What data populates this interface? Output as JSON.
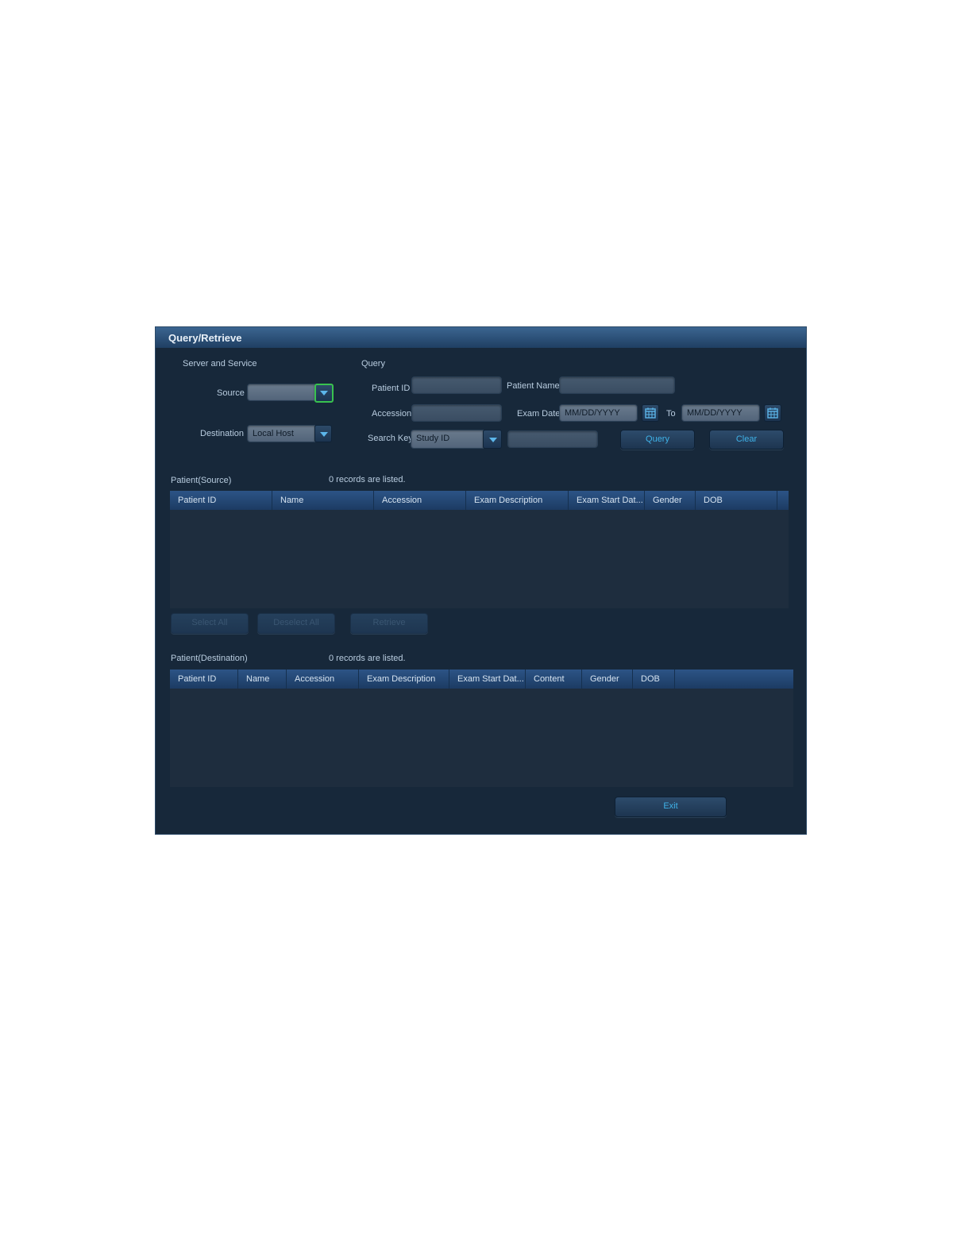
{
  "window": {
    "title": "Query/Retrieve"
  },
  "server": {
    "section_label": "Server and Service",
    "source_label": "Source",
    "source_value": "",
    "destination_label": "Destination",
    "destination_value": "Local Host"
  },
  "query": {
    "section_label": "Query",
    "patient_id_label": "Patient ID",
    "patient_id_value": "",
    "patient_name_label": "Patient Name",
    "patient_name_value": "",
    "accession_label": "Accession",
    "accession_value": "",
    "exam_date_label": "Exam Date",
    "exam_date_from": "MM/DD/YYYY",
    "to_label": "To",
    "exam_date_to": "MM/DD/YYYY",
    "search_key_label": "Search Key",
    "search_key_value": "Study ID",
    "search_key_text": "",
    "query_button": "Query",
    "clear_button": "Clear"
  },
  "source_table": {
    "title": "Patient(Source)",
    "records": "0 records are listed.",
    "columns": [
      "Patient ID",
      "Name",
      "Accession",
      "Exam Description",
      "Exam Start Dat...",
      "Gender",
      "DOB"
    ],
    "rows": []
  },
  "source_actions": {
    "select_all": "Select All",
    "deselect_all": "Deselect All",
    "retrieve": "Retrieve"
  },
  "destination_table": {
    "title": "Patient(Destination)",
    "records": "0 records are listed.",
    "columns": [
      "Patient ID",
      "Name",
      "Accession",
      "Exam Description",
      "Exam Start Dat...",
      "Content",
      "Gender",
      "DOB"
    ],
    "rows": []
  },
  "footer": {
    "exit_button": "Exit"
  },
  "colors": {
    "background": "#17283a",
    "header": "#2c5486",
    "accent": "#3fb2e8",
    "focus": "#39c24f"
  }
}
